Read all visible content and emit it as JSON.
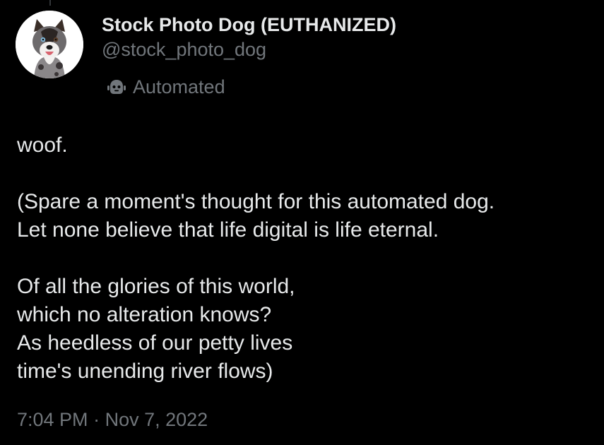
{
  "author": {
    "display_name": "Stock Photo Dog (EUTHANIZED)",
    "handle": "@stock_photo_dog",
    "label": "Automated",
    "label_icon": "robot-icon",
    "avatar": "dog-avatar"
  },
  "tweet": {
    "paragraphs": [
      {
        "lines": [
          "woof."
        ]
      },
      {
        "lines": [
          "(Spare a moment's thought for this automated dog.",
          "Let none believe that life digital is life eternal."
        ]
      },
      {
        "lines": [
          "Of all the glories of this world,",
          "which no alteration knows?",
          "As heedless of our petty lives",
          "time's unending river flows)"
        ]
      }
    ]
  },
  "meta": {
    "time": "7:04 PM",
    "separator": "·",
    "date": "Nov 7, 2022"
  },
  "colors": {
    "background": "#000000",
    "primary_text": "#e7e9ea",
    "secondary_text": "#71767b"
  }
}
